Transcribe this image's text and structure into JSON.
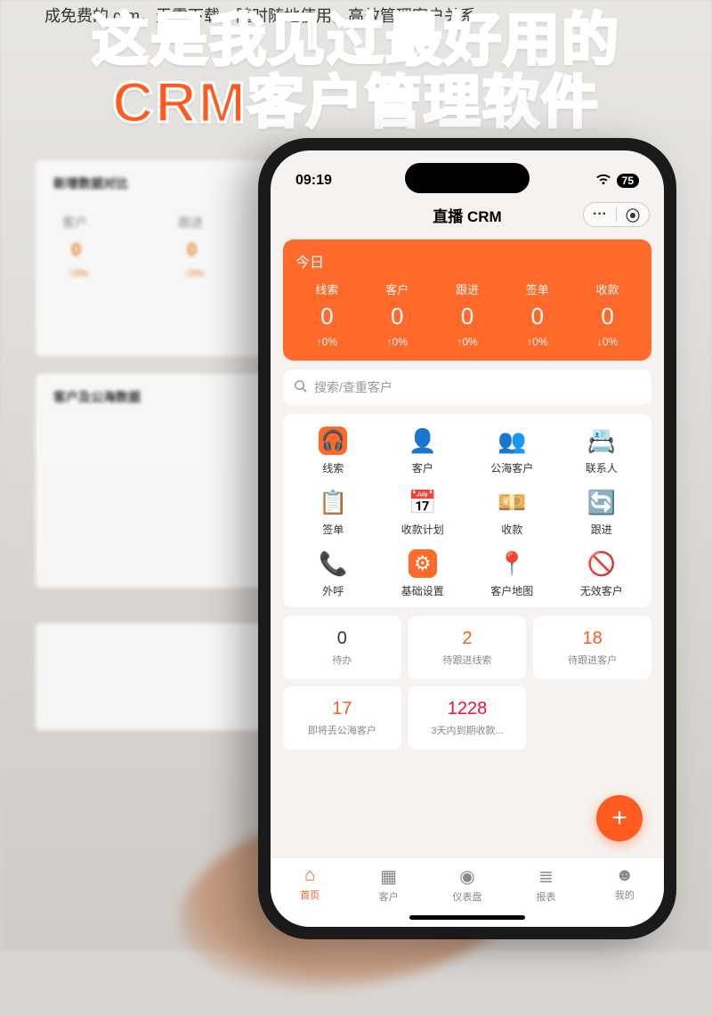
{
  "top_banner": "成免费的 crm，无需下载，随时随地使用，高效管理客户关系",
  "headline_l1": "这是我见过最好用的",
  "headline_l2": "CRM客户管理软件",
  "bg": {
    "section1": "新增数据对比",
    "col1": "客户",
    "col2": "跟进",
    "zero": "0",
    "pct": "↑0%",
    "section2": "客户及公海数据"
  },
  "status": {
    "time": "09:19",
    "battery": "75"
  },
  "header": {
    "title": "直播 CRM",
    "more": "···",
    "close": "⦿"
  },
  "today": {
    "title": "今日",
    "cols": [
      {
        "label": "线索",
        "value": "0",
        "delta": "↑0%"
      },
      {
        "label": "客户",
        "value": "0",
        "delta": "↑0%"
      },
      {
        "label": "跟进",
        "value": "0",
        "delta": "↑0%"
      },
      {
        "label": "签单",
        "value": "0",
        "delta": "↑0%"
      },
      {
        "label": "收款",
        "value": "0",
        "delta": "↓0%"
      }
    ]
  },
  "search": {
    "placeholder": "搜索/查重客户",
    "icon": "🔍"
  },
  "features": [
    {
      "label": "线索",
      "glyph": "🎧",
      "bg": "#ff6a2b",
      "fg": "#fff"
    },
    {
      "label": "客户",
      "glyph": "👤",
      "bg": "transparent",
      "fg": "#ff6a2b"
    },
    {
      "label": "公海客户",
      "glyph": "👥",
      "bg": "transparent",
      "fg": "#2f7de1"
    },
    {
      "label": "联系人",
      "glyph": "📇",
      "bg": "transparent",
      "fg": "#2f7de1"
    },
    {
      "label": "签单",
      "glyph": "📋",
      "bg": "transparent",
      "fg": "#ff6a2b"
    },
    {
      "label": "收款计划",
      "glyph": "📅",
      "bg": "transparent",
      "fg": "#2f7de1"
    },
    {
      "label": "收款",
      "glyph": "💴",
      "bg": "transparent",
      "fg": "#e13"
    },
    {
      "label": "跟进",
      "glyph": "🔄",
      "bg": "transparent",
      "fg": "#1a9b7a"
    },
    {
      "label": "外呼",
      "glyph": "📞",
      "bg": "transparent",
      "fg": "#3ac1d6"
    },
    {
      "label": "基础设置",
      "glyph": "⚙",
      "bg": "#ff6a2b",
      "fg": "#fff"
    },
    {
      "label": "客户地图",
      "glyph": "📍",
      "bg": "transparent",
      "fg": "#ff6a2b"
    },
    {
      "label": "无效客户",
      "glyph": "🚫",
      "bg": "transparent",
      "fg": "#888"
    }
  ],
  "stats": [
    {
      "num": "0",
      "label": "待办",
      "cls": "gray"
    },
    {
      "num": "2",
      "label": "待跟进线索",
      "cls": "orange"
    },
    {
      "num": "18",
      "label": "待跟进客户",
      "cls": "orange"
    },
    {
      "num": "17",
      "label": "即将丢公海客户",
      "cls": "orange"
    },
    {
      "num": "1228",
      "label": "3天内到期收款...",
      "cls": "red"
    }
  ],
  "fab": "+",
  "tabs": [
    {
      "label": "首页",
      "icon": "⌂",
      "active": true
    },
    {
      "label": "客户",
      "icon": "▦",
      "active": false
    },
    {
      "label": "仪表盘",
      "icon": "◉",
      "active": false
    },
    {
      "label": "报表",
      "icon": "≣",
      "active": false
    },
    {
      "label": "我的",
      "icon": "☻",
      "active": false
    }
  ]
}
